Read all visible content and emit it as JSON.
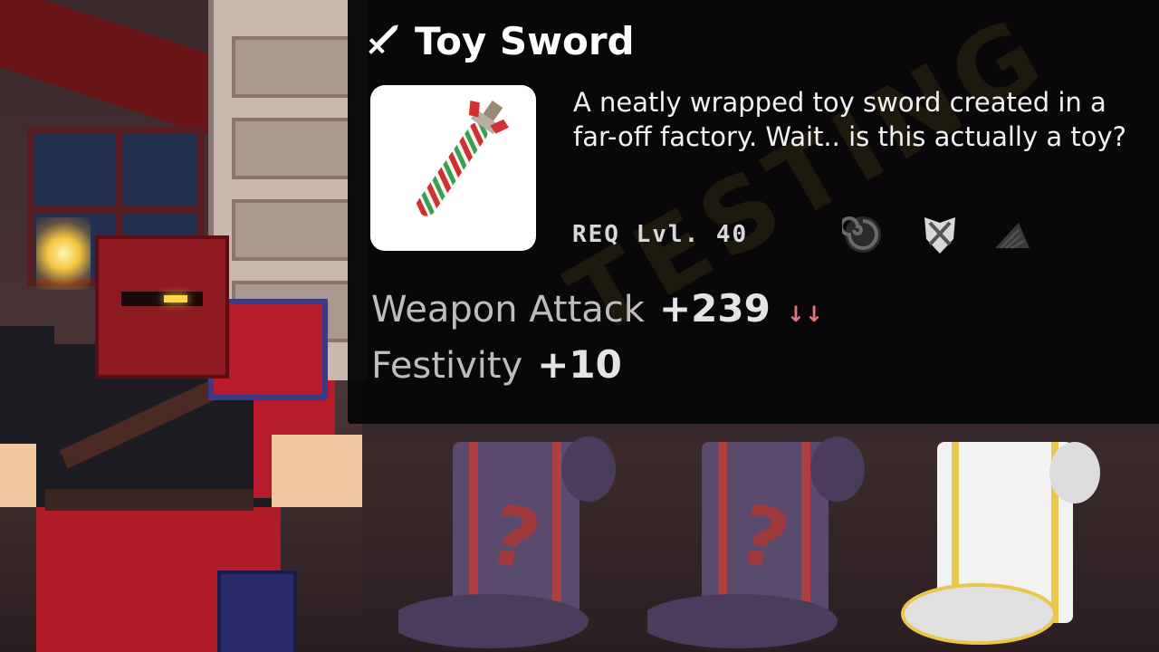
{
  "tooltip": {
    "title": "Toy Sword",
    "title_icon": "sword-icon",
    "description": "A neatly wrapped toy sword created in a far-off factory. Wait.. is this actually a toy?",
    "requirement": "REQ Lvl. 40",
    "requirement_icons": [
      "swirl-icon",
      "crest-shield-icon",
      "fin-icon"
    ],
    "stats": [
      {
        "label": "Weapon Attack",
        "value": "+239",
        "indicator": "↓↓",
        "indicator_color": "#e4767a"
      },
      {
        "label": "Festivity",
        "value": "+10"
      }
    ]
  },
  "watermark": "TESTING",
  "scrolls": [
    {
      "name": "mystery-scroll-1",
      "color": "#5a4a6e",
      "mark": "?"
    },
    {
      "name": "mystery-scroll-2",
      "color": "#5a4a6e",
      "mark": "?"
    },
    {
      "name": "white-gold-scroll",
      "color": "#f2f2f2",
      "trim": "#e8c84a"
    }
  ],
  "colors": {
    "tooltip_bg": "#080608",
    "title_text": "#ffffff",
    "stat_label": "#bdbdbd",
    "stat_value": "#e4e4e4"
  }
}
